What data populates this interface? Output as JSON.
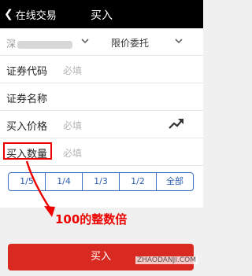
{
  "header": {
    "back_label": "在线交易",
    "title": "买入"
  },
  "form": {
    "account_prefix": "深",
    "order_type": "限价委托",
    "code_label": "证券代码",
    "code_placeholder": "必填",
    "name_label": "证券名称",
    "price_label": "买入价格",
    "price_placeholder": "必填",
    "qty_label": "买入数量",
    "qty_placeholder": "必填"
  },
  "fractions": [
    "1/5",
    "1/4",
    "1/3",
    "1/2",
    "全部"
  ],
  "annotation": "100的整数倍",
  "buy_button_label": "买入",
  "watermark": "ZHAODANJI.COM",
  "colors": {
    "accent_red": "#d92a22",
    "highlight_red": "#ee0000",
    "fraction_blue": "#3a6fc4"
  }
}
